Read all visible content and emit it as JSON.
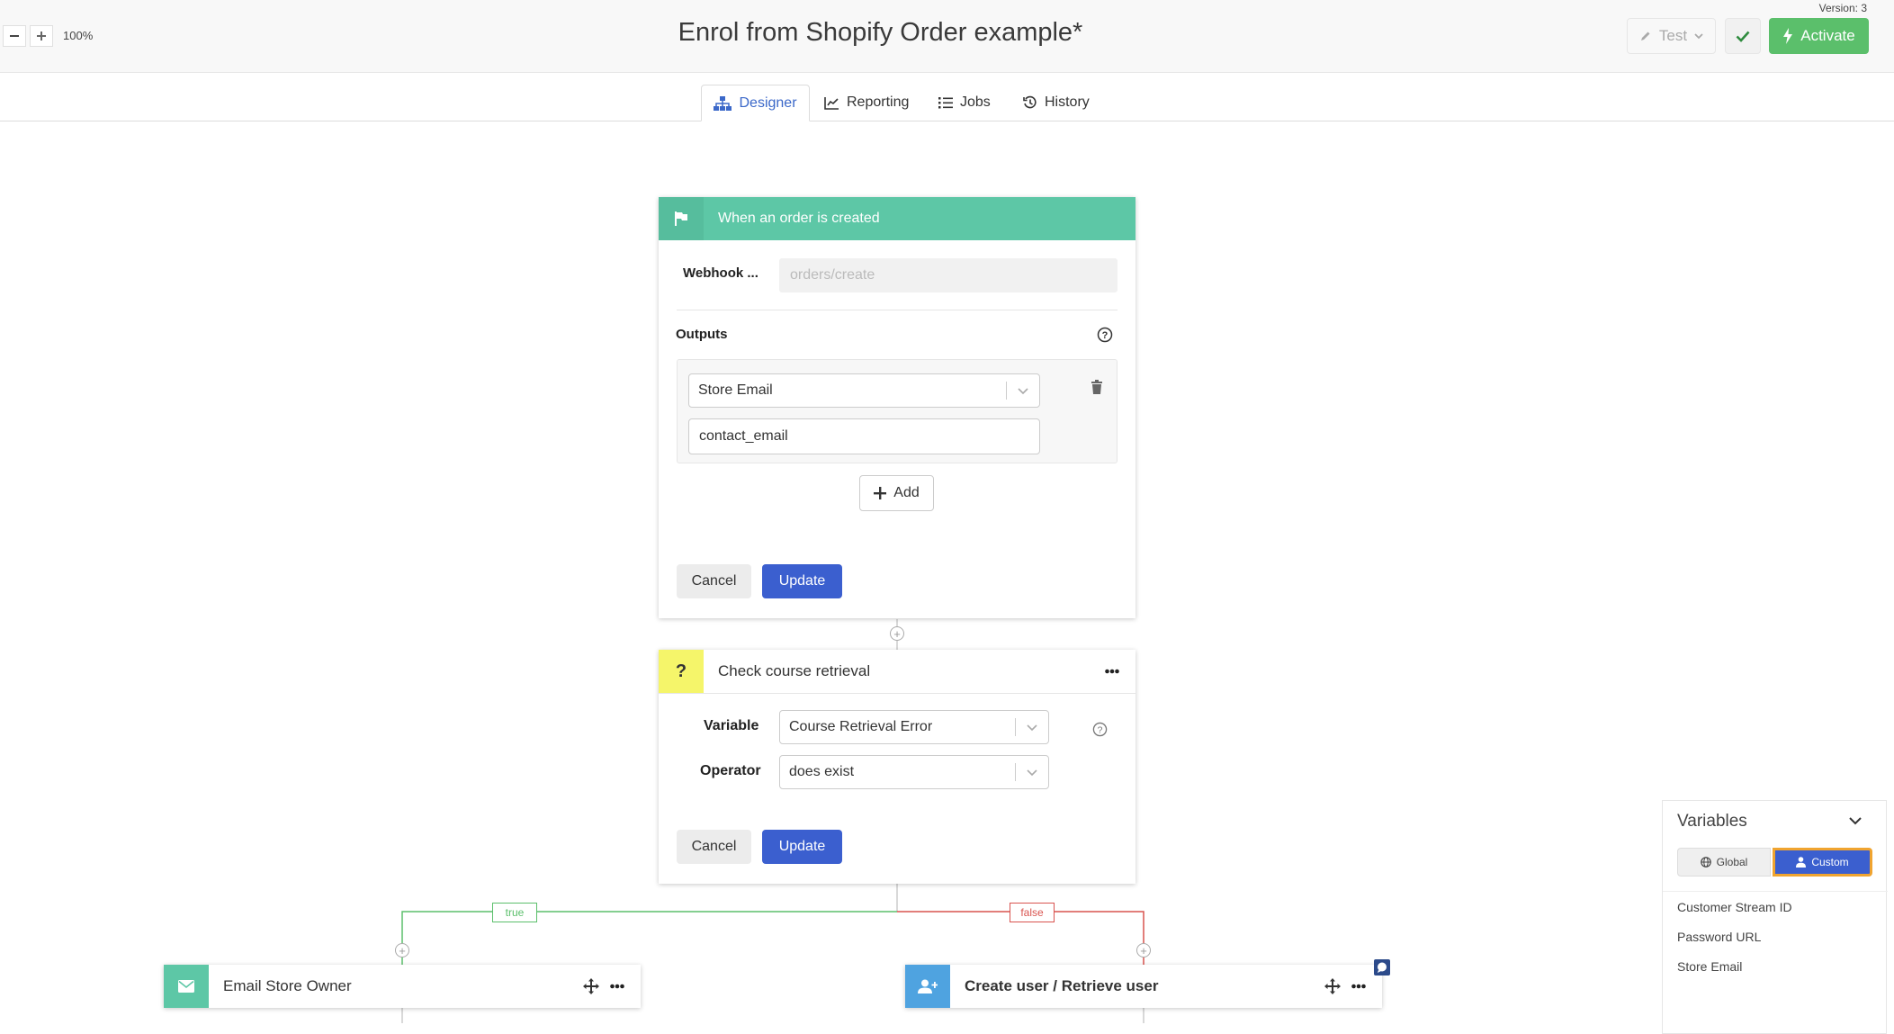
{
  "header": {
    "title": "Enrol from Shopify Order example*",
    "version": "Version: 3",
    "zoom_level": "100%",
    "test_label": "Test",
    "activate_label": "Activate"
  },
  "tabs": [
    {
      "label": "Designer",
      "icon": "sitemap-icon",
      "active": true
    },
    {
      "label": "Reporting",
      "icon": "chart-line-icon",
      "active": false
    },
    {
      "label": "Jobs",
      "icon": "list-icon",
      "active": false
    },
    {
      "label": "History",
      "icon": "history-icon",
      "active": false
    }
  ],
  "trigger_card": {
    "title": "When an order is created",
    "webhook_label": "Webhook ...",
    "webhook_value": "orders/create",
    "outputs_label": "Outputs",
    "output_select": "Store Email",
    "output_value": "contact_email",
    "add_label": "Add",
    "cancel_label": "Cancel",
    "update_label": "Update"
  },
  "condition_card": {
    "icon_text": "?",
    "title": "Check course retrieval",
    "variable_label": "Variable",
    "variable_value": "Course Retrieval Error",
    "operator_label": "Operator",
    "operator_value": "does exist",
    "cancel_label": "Cancel",
    "update_label": "Update"
  },
  "branches": {
    "true_label": "true",
    "false_label": "false"
  },
  "nodes": {
    "email_title": "Email Store Owner",
    "create_user_title": "Create user / Retrieve user"
  },
  "variables_panel": {
    "title": "Variables",
    "global_label": "Global",
    "custom_label": "Custom",
    "items": [
      "Customer Stream ID",
      "Password URL",
      "Store Email"
    ]
  },
  "colors": {
    "accent_blue": "#3b5fcf",
    "trigger_green": "#5dc7a6",
    "activate_green": "#5bbf6b",
    "condition_yellow": "#f5f56a",
    "true_green": "#5bbf6b",
    "false_red": "#d9534f"
  }
}
